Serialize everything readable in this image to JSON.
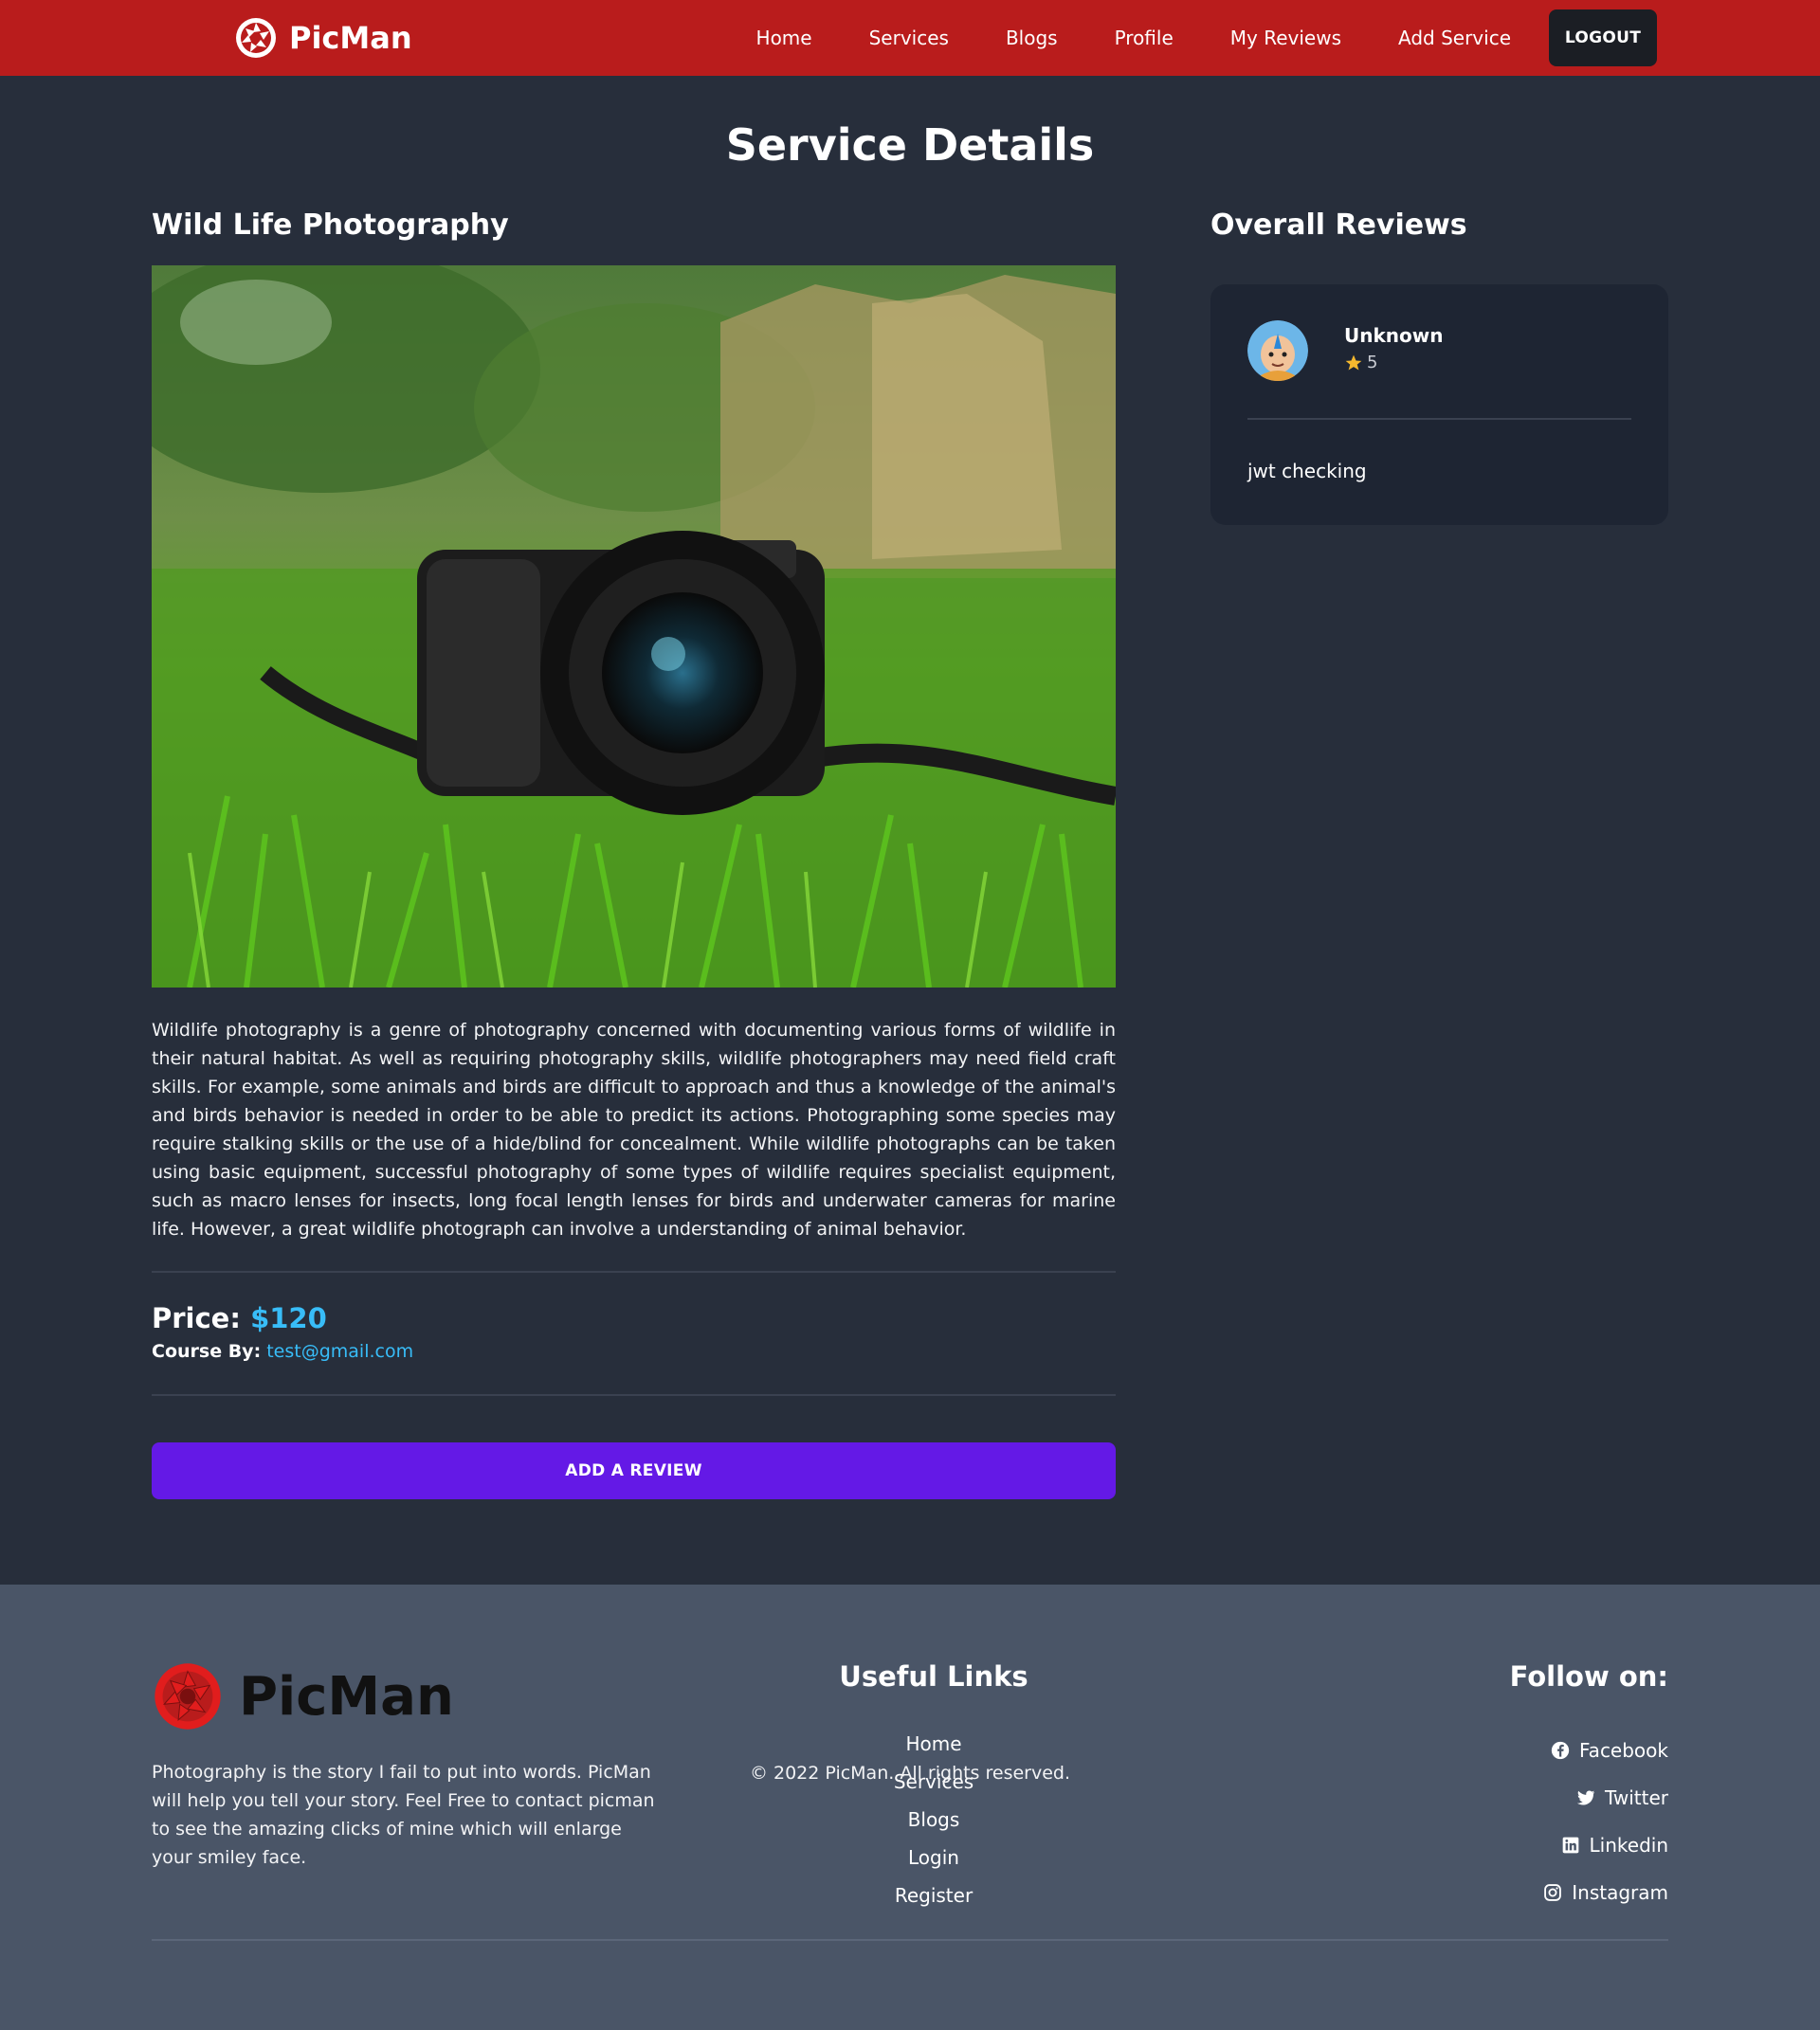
{
  "nav": {
    "brand": "PicMan",
    "links": [
      "Home",
      "Services",
      "Blogs",
      "Profile",
      "My Reviews",
      "Add Service"
    ],
    "logout_label": "LOGOUT"
  },
  "page": {
    "title": "Service Details"
  },
  "service": {
    "title": "Wild Life Photography",
    "description": "Wildlife photography is a genre of photography concerned with documenting various forms of wildlife in their natural habitat. As well as requiring photography skills, wildlife photographers may need field craft skills. For example, some animals and birds are difficult to approach and thus a knowledge of the animal's and birds behavior is needed in order to be able to predict its actions. Photographing some species may require stalking skills or the use of a hide/blind for concealment. While wildlife photographs can be taken using basic equipment, successful photography of some types of wildlife requires specialist equipment, such as macro lenses for insects, long focal length lenses for birds and underwater cameras for marine life. However, a great wildlife photograph can involve a understanding of animal behavior.",
    "price_label": "Price:",
    "price_value": "$120",
    "course_by_label": "Course By:",
    "course_by_email": "test@gmail.com",
    "add_review_label": "ADD A REVIEW"
  },
  "reviews": {
    "title": "Overall Reviews",
    "items": [
      {
        "name": "Unknown",
        "rating": "5",
        "text": "jwt checking"
      }
    ]
  },
  "footer": {
    "brand": "PicMan",
    "description": "Photography is the story I fail to put into words. PicMan will help you tell your story. Feel Free to contact picman to see the amazing clicks of mine which will enlarge your smiley face.",
    "useful_title": "Useful Links",
    "useful_links": [
      "Home",
      "Services",
      "Blogs",
      "Login",
      "Register"
    ],
    "follow_title": "Follow on:",
    "social": [
      "Facebook",
      "Twitter",
      "Linkedin",
      "Instagram"
    ],
    "copyright": "© 2022 PicMan. All rights reserved."
  },
  "colors": {
    "nav_bg": "#b91c1c",
    "page_bg": "#272e3b",
    "accent_blue": "#38bdf8",
    "button_purple": "#6419e6",
    "footer_bg": "#4a5567"
  },
  "icons": {
    "brand": "camera-aperture-icon",
    "star": "star-icon",
    "facebook": "facebook-icon",
    "twitter": "twitter-icon",
    "linkedin": "linkedin-icon",
    "instagram": "instagram-icon"
  }
}
